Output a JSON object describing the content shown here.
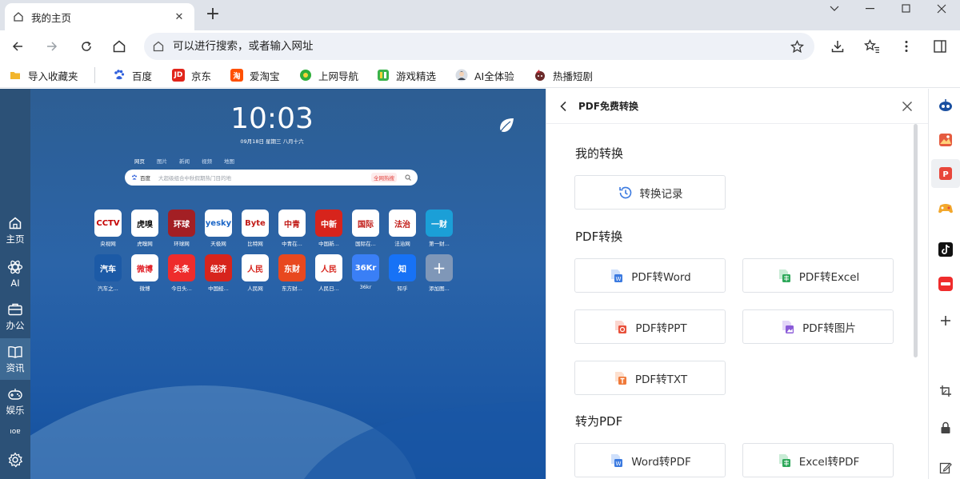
{
  "tab": {
    "title": "我的主页",
    "favicon": "home-icon",
    "close": "✕"
  },
  "newtab": {
    "symbol": "+"
  },
  "toolbar": {
    "omnibox_placeholder": "可以进行搜索，或者输入网址"
  },
  "bookmarks": [
    {
      "label": "导入收藏夹",
      "icon": "folder-icon",
      "color": "#f2b52c"
    },
    {
      "label": "百度",
      "icon": "baidu-icon",
      "color": "#2f5fdc"
    },
    {
      "label": "京东",
      "icon": "jd-icon",
      "color": "#e1251b",
      "glyph": "JD"
    },
    {
      "label": "爱淘宝",
      "icon": "taobao-icon",
      "color": "#ff5000",
      "glyph": "淘"
    },
    {
      "label": "上网导航",
      "icon": "nav-icon",
      "color": "#2fae3a"
    },
    {
      "label": "游戏精选",
      "icon": "game-icon",
      "color": "#3ab34a"
    },
    {
      "label": "AI全体验",
      "icon": "ai-avatar-icon",
      "color": "#6a7b8c"
    },
    {
      "label": "热播短剧",
      "icon": "drama-icon",
      "color": "#c6303a"
    }
  ],
  "leftbar": [
    {
      "label": "主页",
      "icon": "home-icon"
    },
    {
      "label": "AI",
      "icon": "atom-icon"
    },
    {
      "label": "办公",
      "icon": "briefcase-icon"
    },
    {
      "label": "资讯",
      "icon": "book-icon"
    },
    {
      "label": "娱乐",
      "icon": "gamepad-icon"
    }
  ],
  "leftbar_extra_label": "ıoɐ",
  "clock": {
    "time": "10:03",
    "date": "09月18日 星期三 八月十六"
  },
  "search": {
    "tabs": [
      "网页",
      "图片",
      "新闻",
      "视频",
      "地图"
    ],
    "engine": "百度",
    "placeholder": "大超级组合中秋假期热门目的地",
    "hot": "全网热搜"
  },
  "sites": [
    {
      "label": "央视网",
      "bg": "#ffffff",
      "fg": "#c40000",
      "glyph": "CCTV"
    },
    {
      "label": "虎嗅网",
      "bg": "#ffffff",
      "fg": "#111111",
      "glyph": "虎嗅"
    },
    {
      "label": "环球网",
      "bg": "#a31f24",
      "fg": "#ffffff",
      "glyph": "环球"
    },
    {
      "label": "天极网",
      "bg": "#ffffff",
      "fg": "#1b66c7",
      "glyph": "yesky"
    },
    {
      "label": "比特网",
      "bg": "#ffffff",
      "fg": "#c11b17",
      "glyph": "Byte"
    },
    {
      "label": "中青在...",
      "bg": "#ffffff",
      "fg": "#c11b17",
      "glyph": "中青"
    },
    {
      "label": "中国新...",
      "bg": "#d7241c",
      "fg": "#ffffff",
      "glyph": "中新"
    },
    {
      "label": "国际在...",
      "bg": "#ffffff",
      "fg": "#c11b17",
      "glyph": "国际"
    },
    {
      "label": "法治网",
      "bg": "#ffffff",
      "fg": "#c11b17",
      "glyph": "法治"
    },
    {
      "label": "第一财...",
      "bg": "#1b9fd7",
      "fg": "#ffffff",
      "glyph": "一财"
    },
    {
      "label": "汽车之...",
      "bg": "#1c5aa6",
      "fg": "#ffffff",
      "glyph": "汽车"
    },
    {
      "label": "微博",
      "bg": "#ffffff",
      "fg": "#e2232a",
      "glyph": "微博"
    },
    {
      "label": "今日头...",
      "bg": "#ee2c2c",
      "fg": "#ffffff",
      "glyph": "头条"
    },
    {
      "label": "中国经...",
      "bg": "#d7241c",
      "fg": "#ffffff",
      "glyph": "经济"
    },
    {
      "label": "人民网",
      "bg": "#ffffff",
      "fg": "#d7241c",
      "glyph": "人民"
    },
    {
      "label": "东方财...",
      "bg": "#e8481e",
      "fg": "#ffffff",
      "glyph": "东财"
    },
    {
      "label": "人民日...",
      "bg": "#ffffff",
      "fg": "#d7241c",
      "glyph": "人民"
    },
    {
      "label": "36kr",
      "bg": "#3a7ff6",
      "fg": "#ffffff",
      "glyph": "36Kr"
    },
    {
      "label": "知乎",
      "bg": "#1772f6",
      "fg": "#ffffff",
      "glyph": "知"
    },
    {
      "label": "添加图...",
      "bg": "#7f97b8",
      "fg": "#ffffff",
      "glyph": "+"
    }
  ],
  "panel": {
    "title": "PDF免费转换",
    "sections": {
      "mine": "我的转换",
      "pdf_convert": "PDF转换",
      "to_pdf": "转为PDF"
    },
    "buttons": {
      "history": "转换记录",
      "to_word": "PDF转Word",
      "to_excel": "PDF转Excel",
      "to_ppt": "PDF转PPT",
      "to_image": "PDF转图片",
      "to_txt": "PDF转TXT",
      "word_to_pdf": "Word转PDF",
      "excel_to_pdf": "Excel转PDF"
    },
    "colors": {
      "word": "#3b7ae0",
      "excel": "#2ea85a",
      "ppt": "#e8503a",
      "image": "#8a5ad8",
      "txt": "#f07a3a",
      "history": "#3b7ae0"
    }
  },
  "right_sidebar": [
    {
      "icon": "robot-icon",
      "color": "#1a4fa0"
    },
    {
      "icon": "image-app-icon",
      "color": "#e55b3f"
    },
    {
      "icon": "pdf-app-icon",
      "color": "#e8463a"
    },
    {
      "icon": "game-controller-icon",
      "color": "#f2a72c"
    },
    {
      "icon": "tiktok-icon",
      "color": "#111111"
    },
    {
      "icon": "short-drama-icon",
      "color": "#ef2c2c"
    },
    {
      "icon": "plus-icon",
      "color": "#333333"
    },
    {
      "icon": "crop-icon",
      "color": "#444444"
    },
    {
      "icon": "lock-icon",
      "color": "#444444"
    },
    {
      "icon": "edit-icon",
      "color": "#444444"
    }
  ]
}
